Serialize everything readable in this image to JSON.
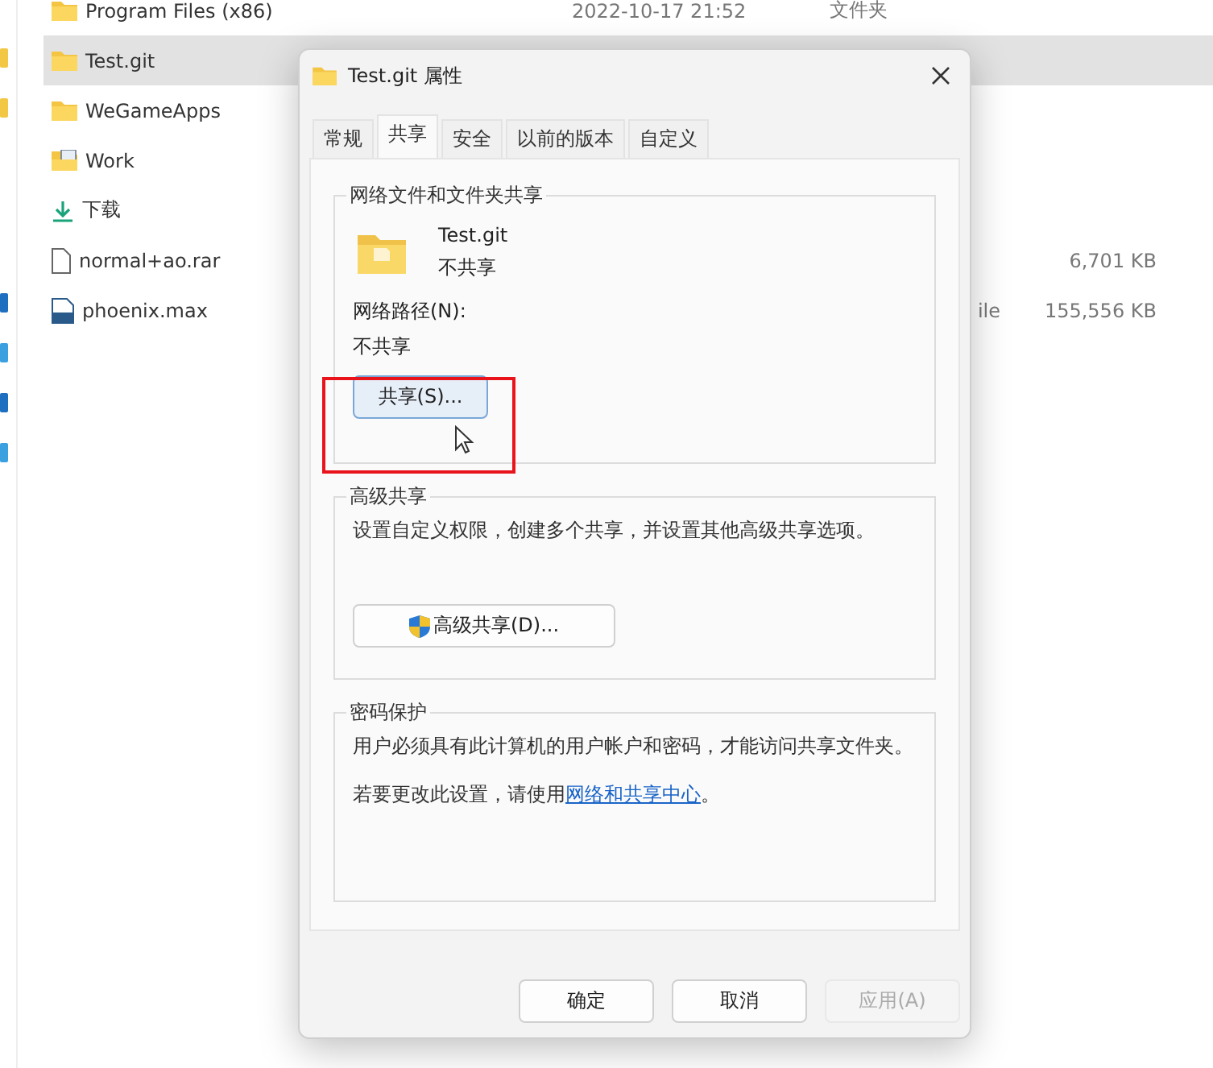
{
  "file_list": {
    "rows": [
      {
        "name": "Program Files (x86)",
        "kind": "folder",
        "selected": false,
        "date": "2022-10-17 21:52",
        "type": "文件夹"
      },
      {
        "name": "Test.git",
        "kind": "folder",
        "selected": true
      },
      {
        "name": "WeGameApps",
        "kind": "folder",
        "selected": false
      },
      {
        "name": "Work",
        "kind": "work_folder",
        "selected": false
      },
      {
        "name": "下载",
        "kind": "download",
        "selected": false
      },
      {
        "name": "normal+ao.rar",
        "kind": "file",
        "selected": false,
        "size": "6,701 KB"
      },
      {
        "name": "phoenix.max",
        "kind": "max_file",
        "selected": false,
        "type": "ile",
        "size": "155,556 KB"
      }
    ]
  },
  "dialog": {
    "title": "Test.git 属性",
    "tabs": [
      {
        "label": "常规",
        "selected": false
      },
      {
        "label": "共享",
        "selected": true
      },
      {
        "label": "安全",
        "selected": false
      },
      {
        "label": "以前的版本",
        "selected": false
      },
      {
        "label": "自定义",
        "selected": false
      }
    ],
    "sharing": {
      "title": "网络文件和文件夹共享",
      "item_name": "Test.git",
      "item_status": "不共享",
      "path_label": "网络路径(N):",
      "path_value": "不共享",
      "button": "共享(S)..."
    },
    "advanced": {
      "title": "高级共享",
      "description": "设置自定义权限，创建多个共享，并设置其他高级共享选项。",
      "button": "高级共享(D)..."
    },
    "password": {
      "title": "密码保护",
      "text": "用户必须具有此计算机的用户帐户和密码，才能访问共享文件夹。",
      "setting_before": "若要更改此设置，请使用",
      "setting_link": "网络和共享中心",
      "setting_after": "。"
    },
    "buttons": [
      {
        "label": "确定",
        "disabled": false
      },
      {
        "label": "取消",
        "disabled": false
      },
      {
        "label": "应用(A)",
        "disabled": true
      }
    ]
  }
}
